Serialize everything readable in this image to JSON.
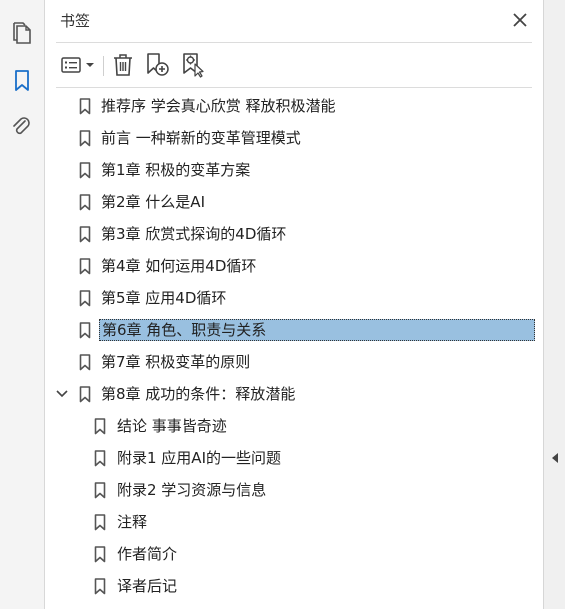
{
  "panel": {
    "title": "书签"
  },
  "toolbar": {
    "options_icon": "options-menu-icon",
    "delete_icon": "trash-icon",
    "new_bookmark_icon": "new-bookmark-icon",
    "find_bookmark_icon": "find-current-bookmark-icon"
  },
  "left_rail": {
    "items": [
      "pages-icon",
      "bookmark-icon",
      "paperclip-icon"
    ],
    "active": "bookmark-icon"
  },
  "bookmarks": [
    {
      "label": "推荐序  学会真心欣赏  释放积极潜能",
      "level": 0
    },
    {
      "label": "前言  一种崭新的变革管理模式",
      "level": 0
    },
    {
      "label": "第1章  积极的变革方案",
      "level": 0
    },
    {
      "label": "第2章  什么是AI",
      "level": 0
    },
    {
      "label": "第3章  欣赏式探询的4D循环",
      "level": 0
    },
    {
      "label": "第4章  如何运用4D循环",
      "level": 0
    },
    {
      "label": "第5章  应用4D循环",
      "level": 0
    },
    {
      "label": "第6章  角色、职责与关系",
      "level": 0,
      "selected": true
    },
    {
      "label": "第7章  积极变革的原则",
      "level": 0
    },
    {
      "label": "第8章  成功的条件：释放潜能",
      "level": 0,
      "expanded": true
    },
    {
      "label": "结论  事事皆奇迹",
      "level": 1
    },
    {
      "label": "附录1  应用AI的一些问题",
      "level": 1
    },
    {
      "label": "附录2  学习资源与信息",
      "level": 1
    },
    {
      "label": "注释",
      "level": 1
    },
    {
      "label": "作者简介",
      "level": 1
    },
    {
      "label": "译者后记",
      "level": 1
    }
  ],
  "colors": {
    "accent": "#1a6fc9",
    "selection": "#99c0e0",
    "icon_gray": "#555555"
  }
}
